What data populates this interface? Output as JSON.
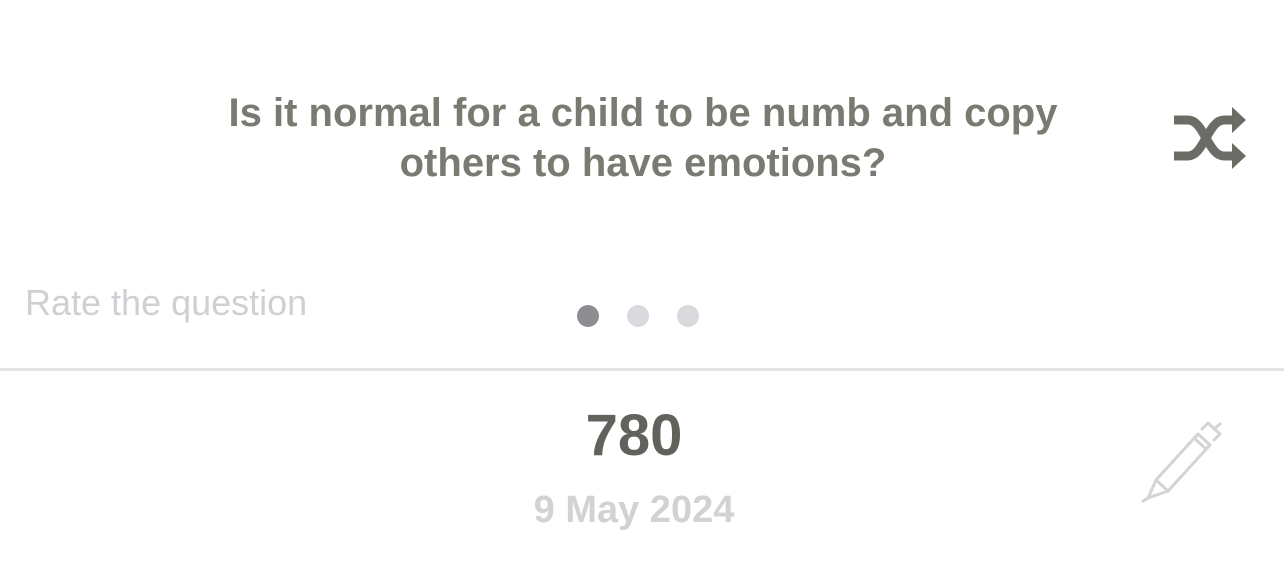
{
  "question": {
    "text": "Is it normal for a child to be numb and copy others to have emotions?"
  },
  "shuffle_button": {
    "icon": "shuffle-icon"
  },
  "rating": {
    "label": "Rate the question"
  },
  "pager": {
    "total": 3,
    "active_index": 0
  },
  "entry": {
    "number": "780",
    "date": "9 May 2024"
  },
  "edit_button": {
    "icon": "pencil-icon"
  },
  "colors": {
    "question_text": "#7a7a72",
    "number_text": "#62625c",
    "muted_text": "#d2d2d2",
    "dot_active": "#8e8e92",
    "dot_inactive": "#dadade",
    "divider": "#e4e4e6"
  }
}
